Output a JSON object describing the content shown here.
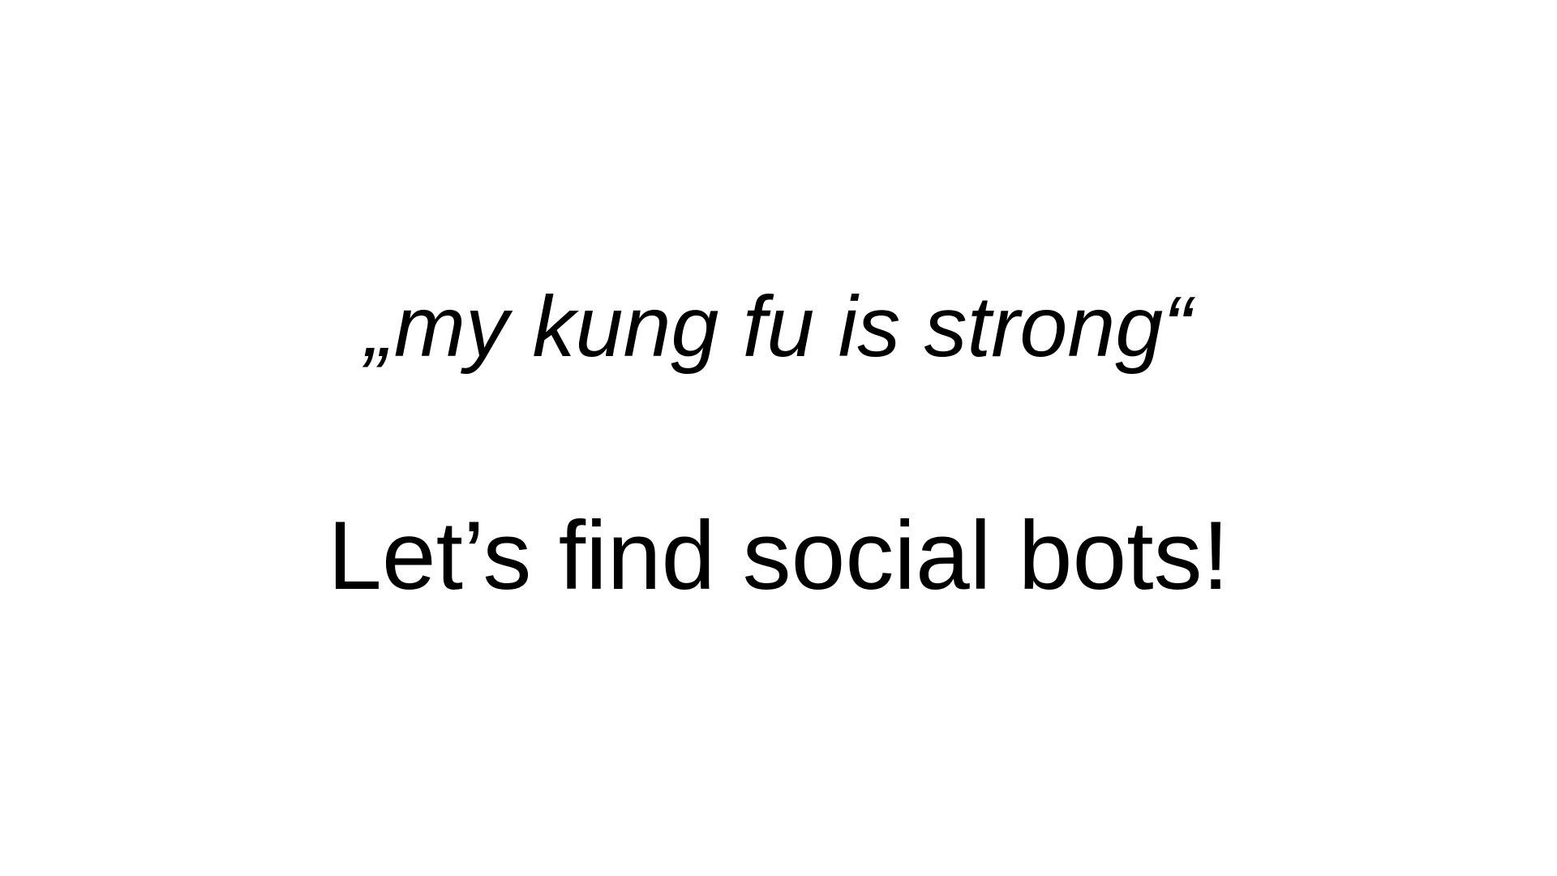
{
  "slide": {
    "quote": "„my kung fu is strong“",
    "headline": "Let’s find social bots!",
    "background_color": "#ffffff",
    "text_color": "#000000"
  }
}
